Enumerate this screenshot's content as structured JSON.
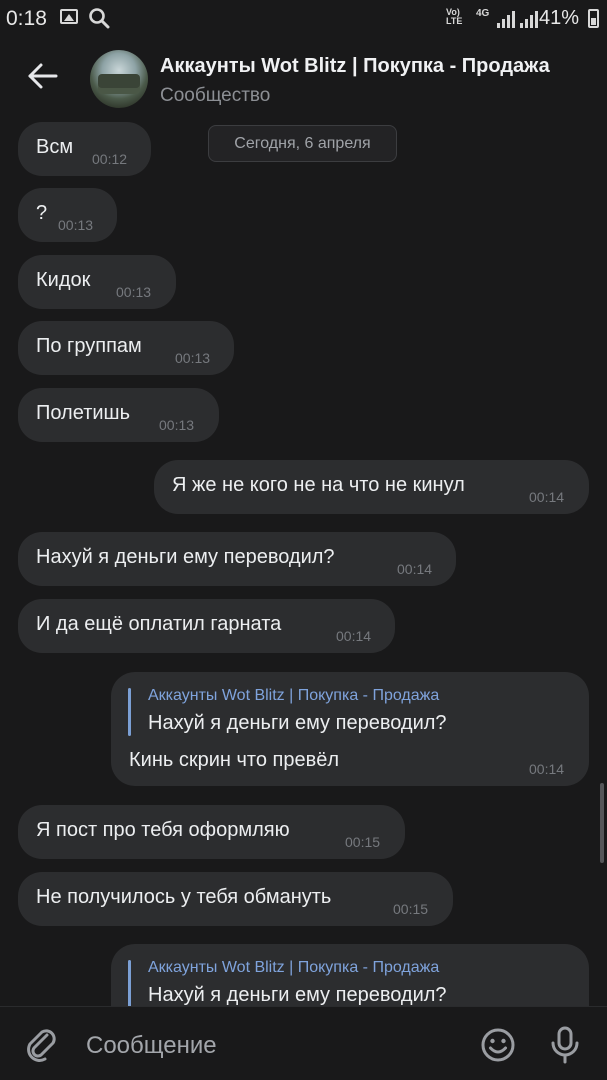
{
  "status_bar": {
    "time": "0:18",
    "lte_top": "Vo)",
    "lte_bottom": "LTE",
    "network": "4G",
    "battery": "41%",
    "icons": [
      "image-icon",
      "search-icon",
      "signal-icon",
      "battery-icon"
    ]
  },
  "header": {
    "title": "Аккаунты Wot Blitz | Покупка - Продажа",
    "subtitle": "Сообщество"
  },
  "date_separator": "Сегодня, 6 апреля",
  "messages": [
    {
      "dir": "in",
      "text": "Всм",
      "time": "00:12"
    },
    {
      "dir": "in",
      "text": "?",
      "time": "00:13"
    },
    {
      "dir": "in",
      "text": "Кидок",
      "time": "00:13"
    },
    {
      "dir": "in",
      "text": "По группам",
      "time": "00:13"
    },
    {
      "dir": "in",
      "text": "Полетишь",
      "time": "00:13"
    },
    {
      "dir": "out",
      "text": "Я же не кого не на что не кинул",
      "time": "00:14"
    },
    {
      "dir": "in",
      "text": "Нахуй я деньги ему переводил?",
      "time": "00:14"
    },
    {
      "dir": "in",
      "text": "И да ещё оплатил гарната",
      "time": "00:14"
    },
    {
      "dir": "out",
      "reply_author": "Аккаунты Wot Blitz | Покупка - Продажа",
      "reply_text": "Нахуй я деньги ему переводил?",
      "text": "Кинь скрин что превёл",
      "time": "00:14"
    },
    {
      "dir": "in",
      "text": "Я пост про тебя оформляю",
      "time": "00:15"
    },
    {
      "dir": "in",
      "text": "Не получилось у тебя обмануть",
      "time": "00:15"
    },
    {
      "dir": "out",
      "reply_author": "Аккаунты Wot Blitz | Покупка - Продажа",
      "reply_text": "Нахуй я деньги ему переводил?",
      "text": "",
      "time": ""
    }
  ],
  "composer": {
    "placeholder": "Сообщение"
  },
  "colors": {
    "background": "#19191a",
    "bubble": "#2c2d2f",
    "reply_accent": "#7fa3dc",
    "time": "#76797e"
  }
}
